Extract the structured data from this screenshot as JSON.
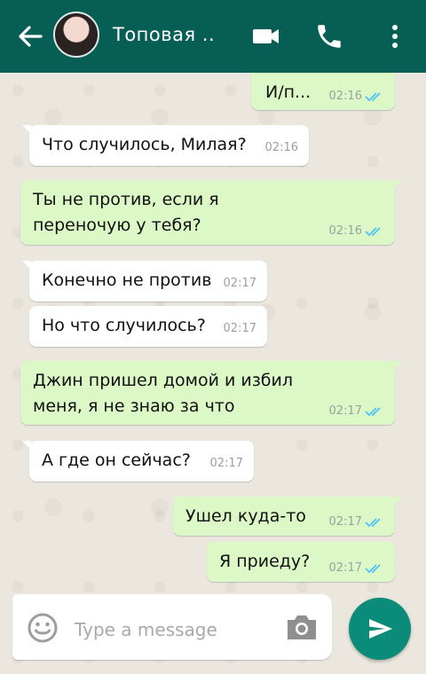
{
  "header": {
    "title": "Топовая ..",
    "back_icon": "arrow-left-icon",
    "video_icon": "videocam-icon",
    "call_icon": "phone-icon",
    "menu_icon": "more-vert-icon"
  },
  "messages": [
    {
      "text": "И/п...",
      "time": "02:16",
      "dir": "out",
      "status": "read"
    },
    {
      "text": "Что случилось, Милая?",
      "time": "02:16",
      "dir": "in"
    },
    {
      "text": "Ты не против, если я переночую у тебя?",
      "time": "02:16",
      "dir": "out",
      "status": "read"
    },
    {
      "text": "Конечно не против",
      "time": "02:17",
      "dir": "in"
    },
    {
      "text": "Но что случилось?",
      "time": "02:17",
      "dir": "in"
    },
    {
      "text": "Джин пришел домой и избил меня, я не знаю за что",
      "time": "02:17",
      "dir": "out",
      "status": "read"
    },
    {
      "text": "А где он сейчас?",
      "time": "02:17",
      "dir": "in"
    },
    {
      "text": "Ушел куда-то",
      "time": "02:17",
      "dir": "out",
      "status": "read"
    },
    {
      "text": "Я приеду?",
      "time": "02:17",
      "dir": "out",
      "status": "read"
    }
  ],
  "composer": {
    "placeholder": "Type a message",
    "emoji_icon": "emoji-icon",
    "camera_icon": "camera-icon",
    "send_icon": "send-icon"
  },
  "colors": {
    "header": "#075e54",
    "outgoing_bubble": "#dcf8c6",
    "incoming_bubble": "#ffffff",
    "read_ticks": "#4fc3f7",
    "send_button": "#0b8c7a"
  }
}
